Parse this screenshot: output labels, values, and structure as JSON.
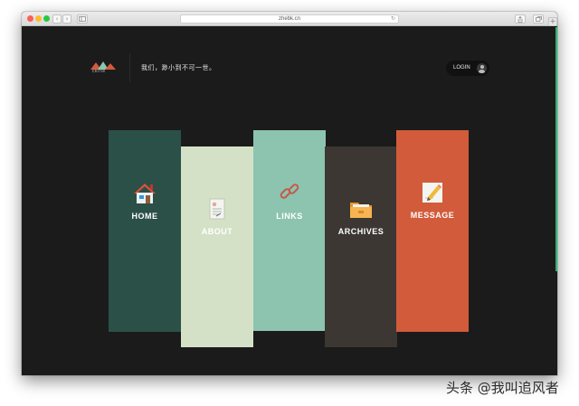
{
  "browser": {
    "url": "zhebk.cn",
    "back_glyph": "‹",
    "forward_glyph": "›",
    "reload_glyph": "↻",
    "new_tab_glyph": "+"
  },
  "header": {
    "logo_text": "ckirie",
    "tagline": "我们，渺小到不可一世。",
    "login_label": "LOGIN"
  },
  "nav": {
    "items": [
      {
        "label": "HOME",
        "icon": "house-icon",
        "color": "#2b5047"
      },
      {
        "label": "ABOUT",
        "icon": "document-icon",
        "color": "#d4e1c6"
      },
      {
        "label": "LINKS",
        "icon": "chain-link-icon",
        "color": "#8dc4b0"
      },
      {
        "label": "ARCHIVES",
        "icon": "folder-icon",
        "color": "#3c3732"
      },
      {
        "label": "MESSAGE",
        "icon": "notepad-pencil-icon",
        "color": "#d25b3b"
      }
    ]
  },
  "watermark": "头条 @我叫追风者"
}
